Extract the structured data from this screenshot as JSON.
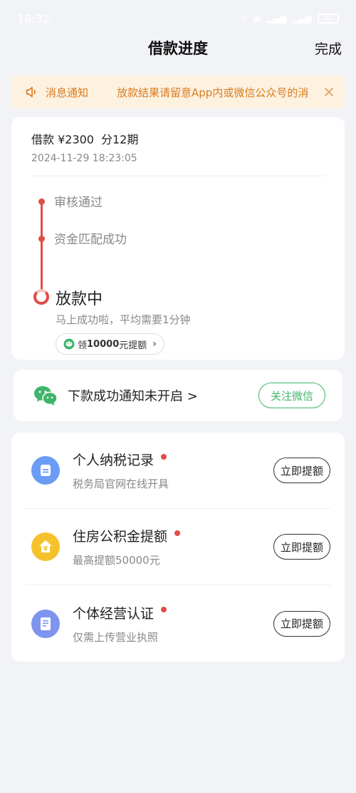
{
  "status_bar": {
    "time": "18:32",
    "icons": [
      "silent-icon",
      "hd-icon",
      "signal-5g-icon",
      "signal-4g-icon"
    ],
    "battery": "62"
  },
  "nav": {
    "title": "借款进度",
    "done_label": "完成"
  },
  "notice": {
    "label": "消息通知",
    "text": "放款结果请留意App内或微信公众号的消",
    "color": "#d97c1f"
  },
  "progress": {
    "amount_label": "借款 ¥2300",
    "period_label": "分12期",
    "timestamp": "2024-11-29 18:23:05",
    "steps": [
      {
        "label": "审核通过",
        "status": "done"
      },
      {
        "label": "资金匹配成功",
        "status": "done"
      }
    ],
    "current_step": "放款中",
    "current_sub": "马上成功啦，平均需要1分钟",
    "quota_pill": {
      "prefix": "领",
      "amount": "10000",
      "suffix": "元提额"
    },
    "accent": "#e24c46"
  },
  "wechat": {
    "text": "下款成功通知未开启 >",
    "button": "关注微信",
    "color": "#3fb56a"
  },
  "boost_items": [
    {
      "title": "个人纳税记录",
      "sub": "税务局官网在线开具",
      "button": "立即提额",
      "icon": "tax-record-icon",
      "color": "#6b9cf5"
    },
    {
      "title": "住房公积金提额",
      "sub": "最高提额50000元",
      "button": "立即提额",
      "icon": "housing-fund-icon",
      "color": "#f5c22b"
    },
    {
      "title": "个体经营认证",
      "sub": "仅需上传营业执照",
      "button": "立即提额",
      "icon": "business-license-icon",
      "color": "#7f94ef"
    }
  ]
}
